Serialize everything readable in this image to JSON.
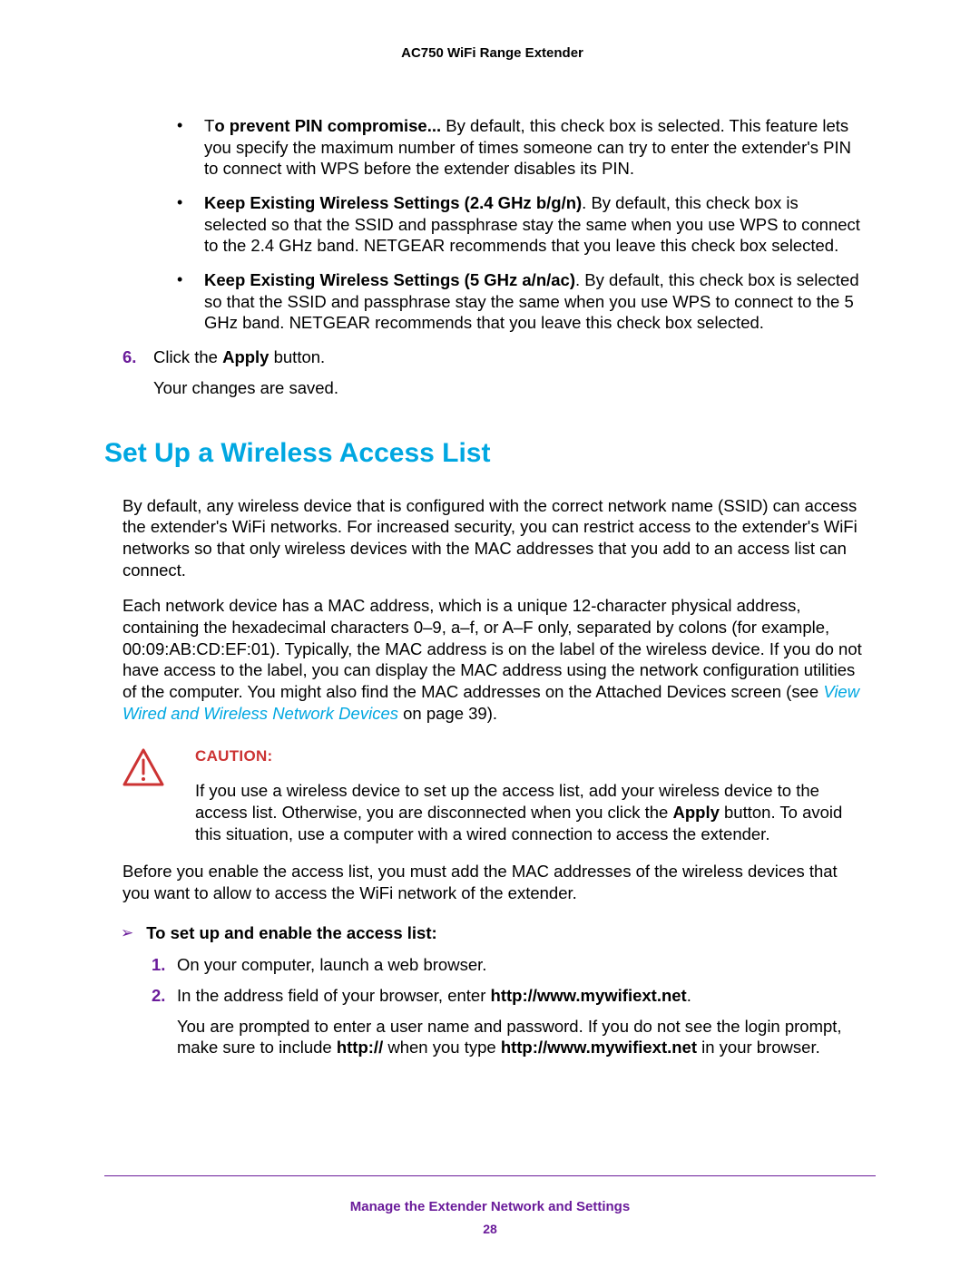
{
  "header": {
    "product": "AC750 WiFi Range Extender"
  },
  "bullets": [
    {
      "lead_prefix": "T",
      "lead_bold": "o prevent PIN compromise...",
      "rest": " By default, this check box is selected. This feature lets you specify the maximum number of times someone can try to enter the extender's PIN to connect with WPS before the extender disables its PIN."
    },
    {
      "lead_bold": "Keep Existing Wireless Settings (2.4 GHz b/g/n)",
      "rest": ". By default, this check box is selected so that the SSID and passphrase stay the same when you use WPS to connect to the 2.4 GHz band. NETGEAR recommends that you leave this check box selected."
    },
    {
      "lead_bold": "Keep Existing Wireless Settings (5 GHz a/n/ac)",
      "rest": ". By default, this check box is selected so that the SSID and passphrase stay the same when you use WPS to connect to the 5 GHz band. NETGEAR recommends that you leave this check box selected."
    }
  ],
  "step6": {
    "num": "6.",
    "pre": "Click the ",
    "bold": "Apply",
    "post": " button.",
    "follow": "Your changes are saved."
  },
  "section": {
    "title": "Set Up a Wireless Access List"
  },
  "intro1": "By default, any wireless device that is configured with the correct network name (SSID) can access the extender's WiFi networks. For increased security, you can restrict access to the extender's WiFi networks so that only wireless devices with the MAC addresses that you add to an access list can connect.",
  "intro2_pre": "Each network device has a MAC address, which is a unique 12-character physical address, containing the hexadecimal characters 0–9, a–f, or A–F only, separated by colons (for example, 00:09:AB:CD:EF:01). Typically, the MAC address is on the label of the wireless device. If you do not have access to the label, you can display the MAC address using the network configuration utilities of the computer. You might also find the MAC addresses on the Attached Devices screen (see ",
  "intro2_link": "View Wired and Wireless Network Devices",
  "intro2_post": " on page 39).",
  "caution": {
    "label": "CAUTION:",
    "t1": "If you use a wireless device to set up the access list, add your wireless device to the access list. Otherwise, you are disconnected when you click the ",
    "bold": "Apply",
    "t2": " button. To avoid this situation, use a computer with a wired connection to access the extender."
  },
  "pre_enable": "Before you enable the access list, you must add the MAC addresses of the wireless devices that you want to allow to access the WiFi network of the extender.",
  "procedure": {
    "title": "To set up and enable the access list:",
    "steps": [
      {
        "num": "1.",
        "text": "On your computer, launch a web browser."
      },
      {
        "num": "2.",
        "pre": "In the address field of your browser, enter ",
        "bold": "http://www.mywifiext.net",
        "post": "."
      }
    ],
    "follow_pre": "You are prompted to enter a user name and password. If you do not see the login prompt, make sure to include ",
    "follow_b1": "http://",
    "follow_mid": " when you type ",
    "follow_b2": "http://www.mywifiext.net",
    "follow_post": " in your browser."
  },
  "footer": {
    "chapter": "Manage the Extender Network and Settings",
    "page": "28"
  }
}
